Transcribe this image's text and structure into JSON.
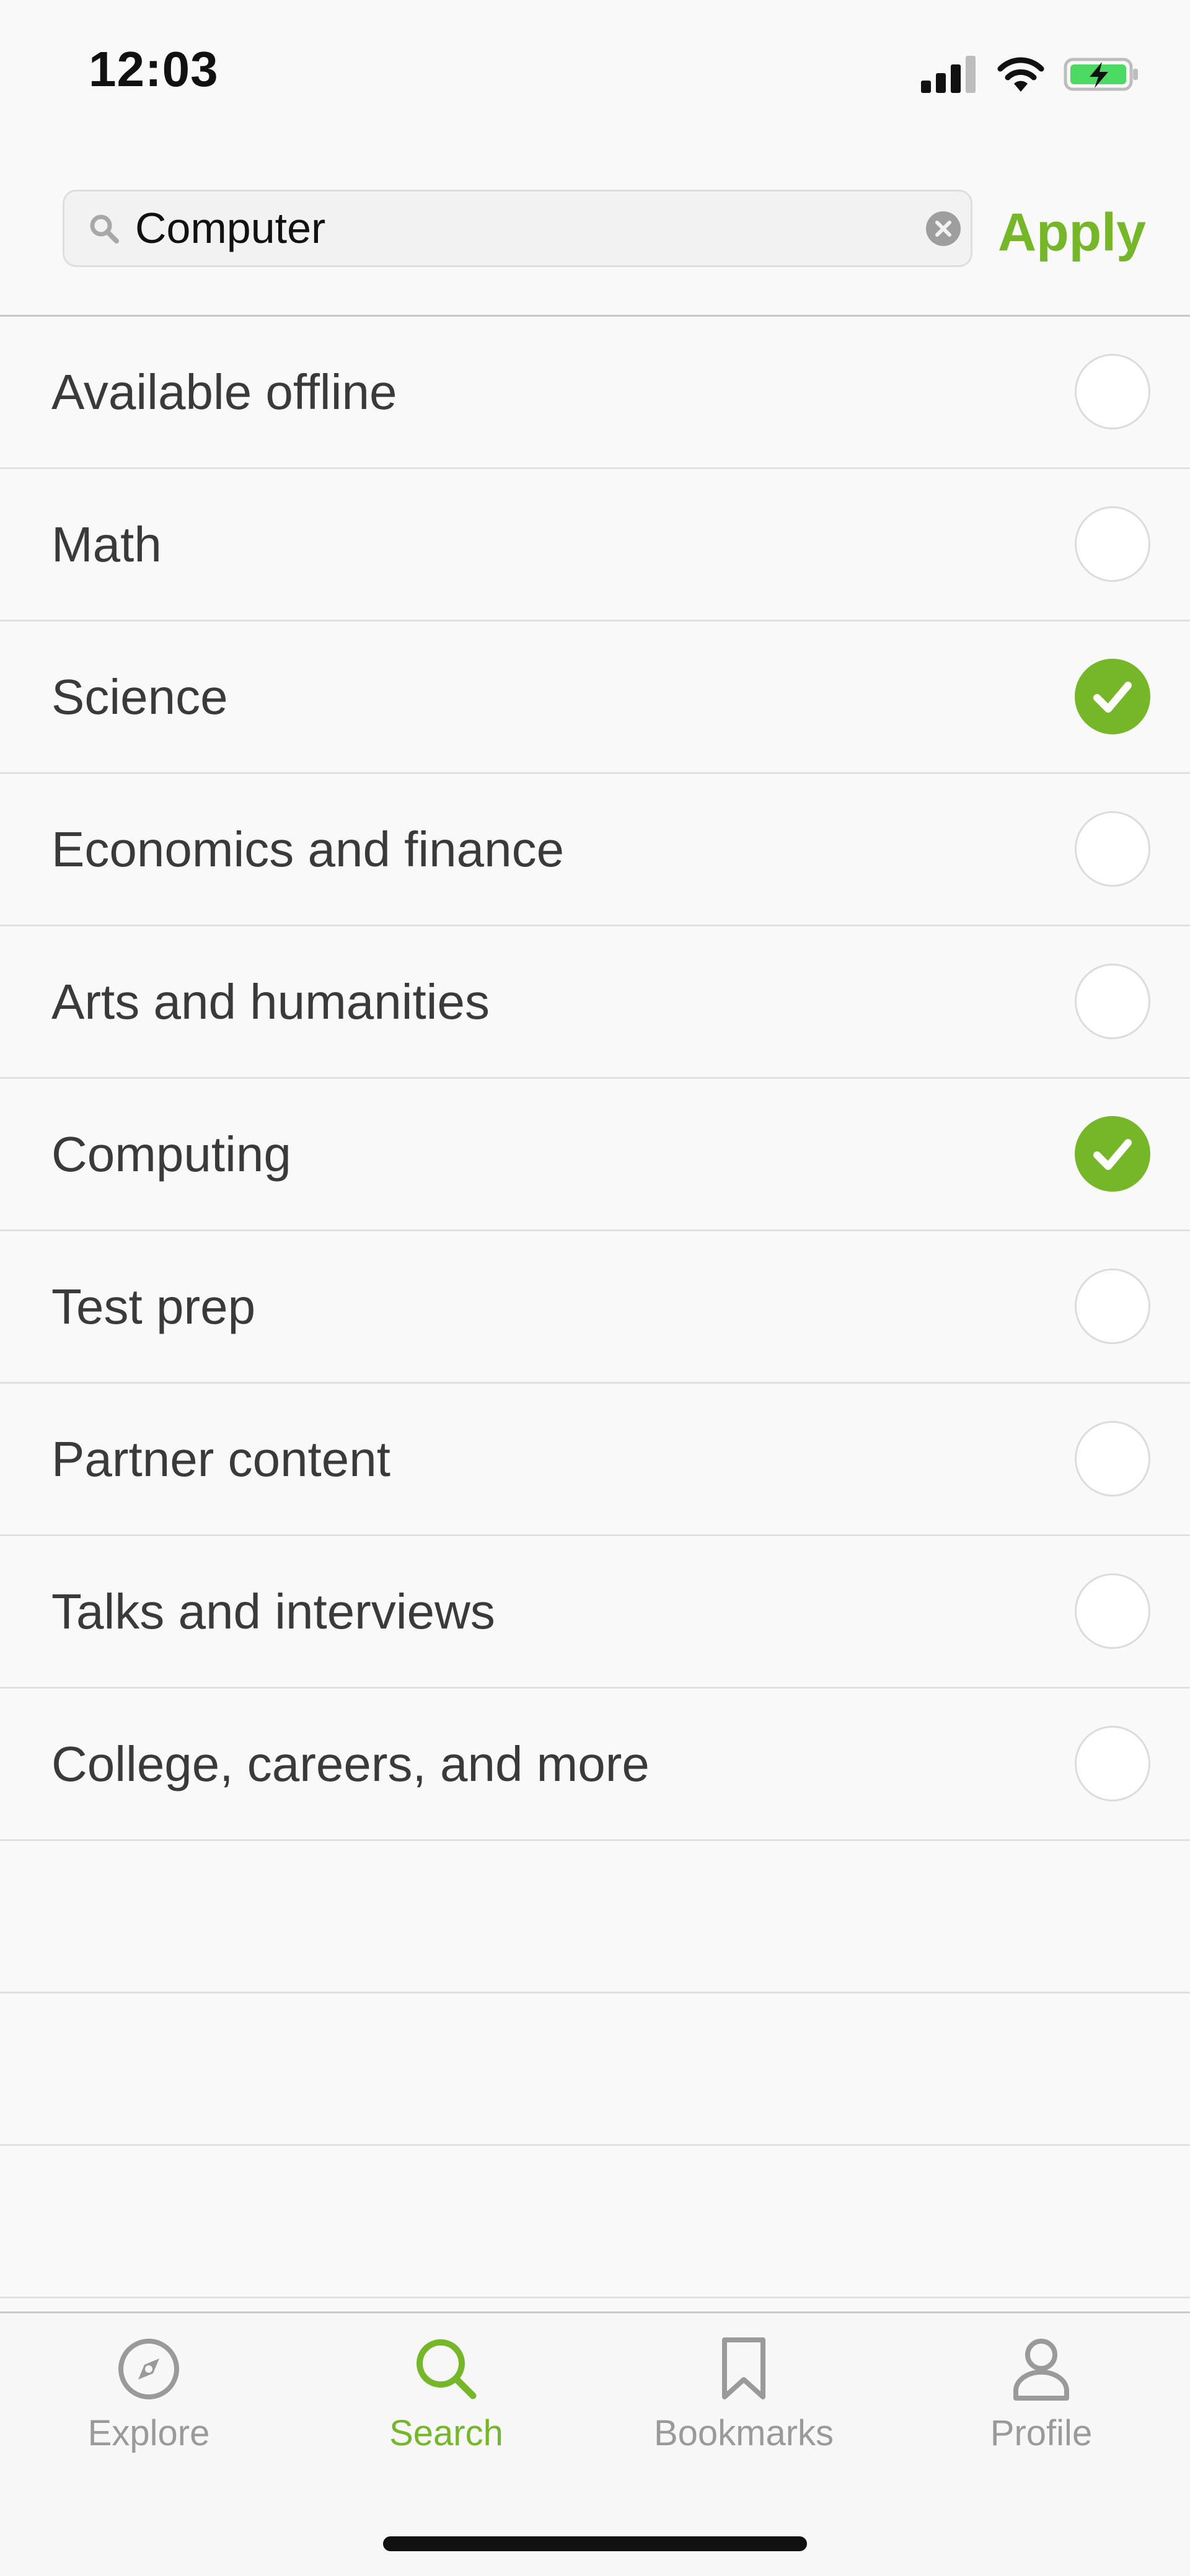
{
  "status_bar": {
    "time": "12:03"
  },
  "search": {
    "query": "Computer",
    "apply_label": "Apply"
  },
  "filters": [
    {
      "label": "Available offline",
      "checked": false
    },
    {
      "label": "Math",
      "checked": false
    },
    {
      "label": "Science",
      "checked": true
    },
    {
      "label": "Economics and finance",
      "checked": false
    },
    {
      "label": "Arts and humanities",
      "checked": false
    },
    {
      "label": "Computing",
      "checked": true
    },
    {
      "label": "Test prep",
      "checked": false
    },
    {
      "label": "Partner content",
      "checked": false
    },
    {
      "label": "Talks and interviews",
      "checked": false
    },
    {
      "label": "College, careers, and more",
      "checked": false
    }
  ],
  "tabs": [
    {
      "label": "Explore",
      "icon": "compass-icon",
      "active": false
    },
    {
      "label": "Search",
      "icon": "search-icon",
      "active": true
    },
    {
      "label": "Bookmarks",
      "icon": "bookmark-icon",
      "active": false
    },
    {
      "label": "Profile",
      "icon": "person-icon",
      "active": false
    }
  ],
  "colors": {
    "accent": "#76b72a",
    "inactive": "#9a9a9a",
    "battery": "#4cd964"
  }
}
